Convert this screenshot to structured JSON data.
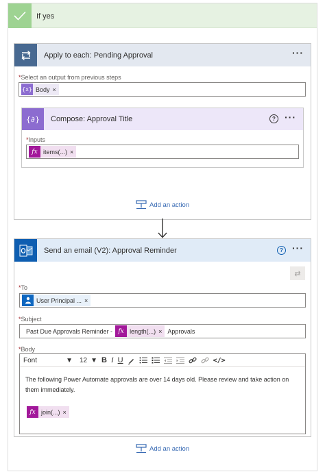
{
  "if_yes": {
    "title": "If yes"
  },
  "apply_each": {
    "title": "Apply to each: Pending Approval",
    "more": "···",
    "select_label": "Select an output from previous steps",
    "select_token": {
      "label": "Body",
      "remove": "×"
    },
    "compose": {
      "title": "Compose: Approval Title",
      "help": "?",
      "more": "···",
      "inputs_label": "Inputs",
      "inputs_token": {
        "label": "items(...)",
        "remove": "×"
      }
    },
    "add_action": "Add an action"
  },
  "email": {
    "title": "Send an email (V2): Approval Reminder",
    "help": "?",
    "more": "···",
    "to_label": "To",
    "to_token": {
      "label": "User Principal ...",
      "remove": "×"
    },
    "subject_label": "Subject",
    "subject_prefix": "Past Due Approvals Reminder -",
    "subject_token": {
      "label": "length(...)",
      "remove": "×"
    },
    "subject_suffix": "Approvals",
    "body_label": "Body",
    "toolbar": {
      "font": "Font",
      "size": "12"
    },
    "body_text": "The following Power Automate approvals are over 14 days old. Please review and take action on them immediately.",
    "body_token": {
      "label": "join(...)",
      "remove": "×"
    }
  },
  "add_action_bottom": "Add an action",
  "required_marker": "*",
  "fx_icon": "fx",
  "colors": {
    "if_yes_bg": "#e6f2e2",
    "if_yes_check": "#9ed392",
    "apply_icon": "#486991",
    "compose_icon": "#8c6cd0",
    "email_icon": "#0e5eb1",
    "fx_token": "#a2189a",
    "link": "#3467b2"
  }
}
